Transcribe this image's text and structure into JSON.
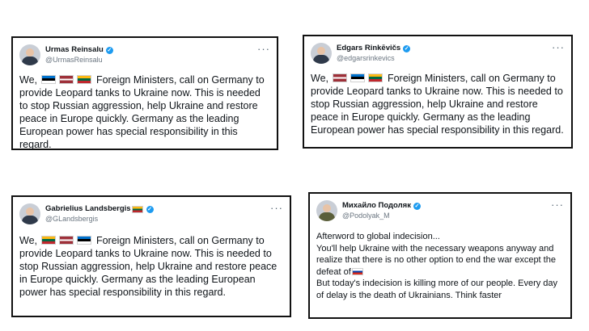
{
  "cards": [
    {
      "name": "Urmas Reinsalu",
      "handle": "@UrmasReinsalu",
      "flags": [
        "ee",
        "lv",
        "lt"
      ],
      "text_pre": "We,",
      "text_post": "Foreign Ministers, call on Germany to provide Leopard tanks to Ukraine now. This is needed to stop Russian aggression, help Ukraine and restore peace in Europe quickly. Germany as the leading European power has special responsibility in this regard."
    },
    {
      "name": "Edgars Rinkēvičs",
      "handle": "@edgarsrinkevics",
      "flags": [
        "lv",
        "ee",
        "lt"
      ],
      "text_pre": "We,",
      "text_post": "Foreign Ministers, call on Germany to provide Leopard tanks to Ukraine now. This is needed to stop Russian aggression, help Ukraine and restore peace in Europe quickly. Germany as the leading European power has special responsibility in this regard."
    },
    {
      "name": "Gabrielius Landsbergis",
      "handle": "@GLandsbergis",
      "name_flag": "lt",
      "flags": [
        "lt",
        "lv",
        "ee"
      ],
      "text_pre": "We,",
      "text_post": "Foreign Ministers, call on Germany to provide Leopard tanks to Ukraine now. This is needed to stop Russian aggression, help Ukraine and restore peace in Europe quickly. Germany as the leading European power has special responsibility in this regard."
    },
    {
      "name": "Михайло Подоляк",
      "handle": "@Podolyak_M",
      "lines": [
        "Afterword to global indecision...",
        "You'll help Ukraine with the necessary weapons anyway and realize that there is no other option to end the war except the defeat of",
        "But today's indecision is killing more of our people. Every day of delay is the death of Ukrainians. Think faster"
      ],
      "inline_flag": "ru"
    }
  ],
  "more_label": "···",
  "verified_glyph": "✓"
}
